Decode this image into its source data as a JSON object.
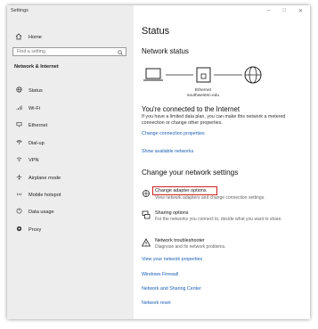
{
  "window": {
    "app_title": "Settings"
  },
  "sidebar": {
    "home_label": "Home",
    "search_placeholder": "Find a setting",
    "section_label": "Network & Internet",
    "items": [
      {
        "label": "Status",
        "icon": "globe-icon"
      },
      {
        "label": "Wi-Fi",
        "icon": "wifi-icon"
      },
      {
        "label": "Ethernet",
        "icon": "ethernet-icon"
      },
      {
        "label": "Dial-up",
        "icon": "phone-icon"
      },
      {
        "label": "VPN",
        "icon": "vpn-icon"
      },
      {
        "label": "Airplane mode",
        "icon": "airplane-icon"
      },
      {
        "label": "Mobile hotspot",
        "icon": "hotspot-icon"
      },
      {
        "label": "Data usage",
        "icon": "data-usage-icon"
      },
      {
        "label": "Proxy",
        "icon": "proxy-icon"
      }
    ]
  },
  "main": {
    "title": "Status",
    "network_status_heading": "Network status",
    "network_name": "Ethernet",
    "network_domain": "southwestsn.edu",
    "connected_heading": "You're connected to the Internet",
    "connected_desc": "If you have a limited data plan, you can make this network a metered connection or change other properties.",
    "link_change_properties": "Change connection properties",
    "link_show_networks": "Show available networks",
    "change_settings_heading": "Change your network settings",
    "options": [
      {
        "title": "Change adapter options",
        "desc": "View network adapters and change connection settings."
      },
      {
        "title": "Sharing options",
        "desc": "For the networks you connect to, decide what you want to share."
      },
      {
        "title": "Network troubleshooter",
        "desc": "Diagnose and fix network problems."
      }
    ],
    "link_view_properties": "View your network properties",
    "link_firewall": "Windows Firewall",
    "link_sharing_center": "Network and Sharing Center",
    "link_reset": "Network reset"
  }
}
